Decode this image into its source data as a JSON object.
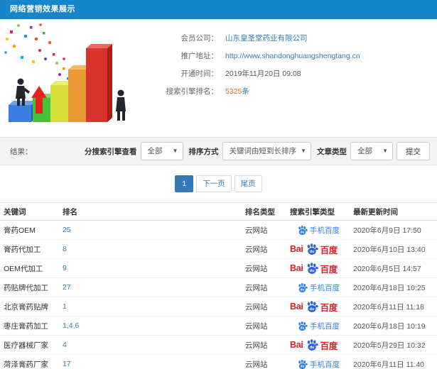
{
  "header": {
    "title": "网络营销效果展示"
  },
  "info": {
    "company_label": "会员公司：",
    "company_value": "山东皇圣堂药业有限公司",
    "url_label": "推广地址：",
    "url_value": "http://www.shandonghuangshengtang.cn",
    "open_time_label": "开通时间：",
    "open_time_value": "2019年11月20日 09:08",
    "rank_label": "搜索引擎排名：",
    "rank_count": "5325",
    "rank_unit": "条"
  },
  "filters": {
    "result_label": "结果：",
    "engine_view_label": "分搜索引擎查看",
    "engine_view_value": "全部",
    "sort_label": "排序方式",
    "sort_value": "关键词由短到长排序",
    "article_type_label": "文章类型",
    "article_type_value": "全部",
    "submit_label": "提交"
  },
  "pagination": {
    "current": "1",
    "next": "下一页",
    "last": "尾页"
  },
  "table": {
    "headers": [
      "关键词",
      "排名",
      "排名类型",
      "搜索引擎类型",
      "最新更新时间"
    ],
    "engine_labels": {
      "mobile": "手机百度",
      "baidu_prefix": "Bai",
      "baidu_suffix": "百度"
    },
    "rows": [
      {
        "keyword": "膏药OEM",
        "rank": "25",
        "rank_type": "云网站",
        "engine": "mobile",
        "updated": "2020年6月9日 17:50"
      },
      {
        "keyword": "膏药代加工",
        "rank": "8",
        "rank_type": "云网站",
        "engine": "baidu",
        "updated": "2020年6月10日 13:40"
      },
      {
        "keyword": "OEM代加工",
        "rank": "9",
        "rank_type": "云网站",
        "engine": "baidu",
        "updated": "2020年6月5日 14:57"
      },
      {
        "keyword": "药贴牌代加工",
        "rank": "27",
        "rank_type": "云网站",
        "engine": "mobile",
        "updated": "2020年6月18日 10:25"
      },
      {
        "keyword": "北京膏药贴牌",
        "rank": "1",
        "rank_type": "云网站",
        "engine": "baidu",
        "updated": "2020年6月11日 11:18"
      },
      {
        "keyword": "枣庄膏药加工",
        "rank": "1,4,6",
        "rank_type": "云网站",
        "engine": "mobile",
        "updated": "2020年6月18日 10:19"
      },
      {
        "keyword": "医疗器械厂家",
        "rank": "4",
        "rank_type": "云网站",
        "engine": "baidu",
        "updated": "2020年5月29日 10:32"
      },
      {
        "keyword": "菏泽膏药厂家",
        "rank": "17",
        "rank_type": "云网站",
        "engine": "mobile",
        "updated": "2020年6月11日 11:40"
      }
    ]
  },
  "colors": {
    "header_bg": "#1786c9",
    "link_blue": "#337ab7",
    "rank_count_orange": "#f26522",
    "baidu_red": "#d6232a",
    "baidu_paw_blue": "#2b5ff0",
    "mobile_baidu_blue": "#2d7ff0",
    "pagination_active_bg": "#337ab7",
    "illustration_bars": [
      "#3b7de0",
      "#46c23a",
      "#d6df3a",
      "#e89a35",
      "#d9342b"
    ]
  }
}
